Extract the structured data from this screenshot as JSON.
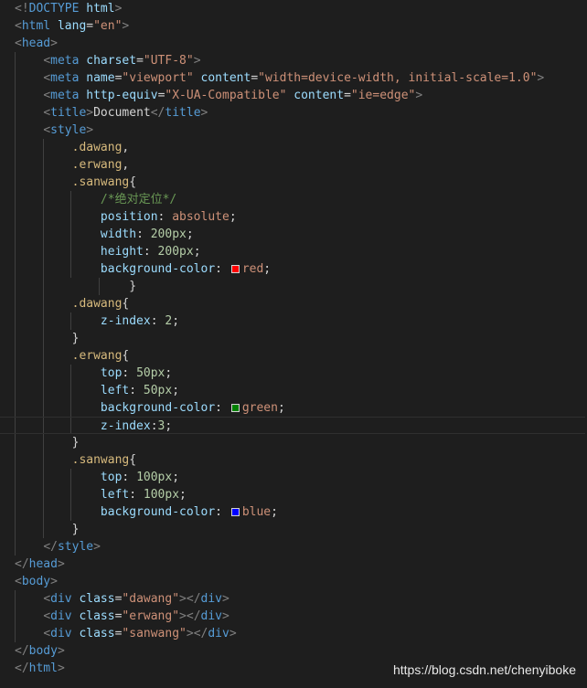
{
  "code_lines": [
    {
      "indent": "",
      "tokens": [
        [
          "pn",
          "<!"
        ],
        [
          "tg",
          "DOCTYPE"
        ],
        [
          "tx",
          " "
        ],
        [
          "at",
          "html"
        ],
        [
          "pn",
          ">"
        ]
      ]
    },
    {
      "indent": "",
      "tokens": [
        [
          "pn",
          "<"
        ],
        [
          "tg",
          "html"
        ],
        [
          "tx",
          " "
        ],
        [
          "at",
          "lang"
        ],
        [
          "tx",
          "="
        ],
        [
          "st",
          "\"en\""
        ],
        [
          "pn",
          ">"
        ]
      ]
    },
    {
      "indent": "",
      "tokens": [
        [
          "pn",
          "<"
        ],
        [
          "tg",
          "head"
        ],
        [
          "pn",
          ">"
        ]
      ]
    },
    {
      "indent": "    ",
      "tokens": [
        [
          "pn",
          "<"
        ],
        [
          "tg",
          "meta"
        ],
        [
          "tx",
          " "
        ],
        [
          "at",
          "charset"
        ],
        [
          "tx",
          "="
        ],
        [
          "st",
          "\"UTF-8\""
        ],
        [
          "pn",
          ">"
        ]
      ]
    },
    {
      "indent": "    ",
      "tokens": [
        [
          "pn",
          "<"
        ],
        [
          "tg",
          "meta"
        ],
        [
          "tx",
          " "
        ],
        [
          "at",
          "name"
        ],
        [
          "tx",
          "="
        ],
        [
          "st",
          "\"viewport\""
        ],
        [
          "tx",
          " "
        ],
        [
          "at",
          "content"
        ],
        [
          "tx",
          "="
        ],
        [
          "st",
          "\"width=device-width, initial-scale=1.0\""
        ],
        [
          "pn",
          ">"
        ]
      ]
    },
    {
      "indent": "    ",
      "tokens": [
        [
          "pn",
          "<"
        ],
        [
          "tg",
          "meta"
        ],
        [
          "tx",
          " "
        ],
        [
          "at",
          "http-equiv"
        ],
        [
          "tx",
          "="
        ],
        [
          "st",
          "\"X-UA-Compatible\""
        ],
        [
          "tx",
          " "
        ],
        [
          "at",
          "content"
        ],
        [
          "tx",
          "="
        ],
        [
          "st",
          "\"ie=edge\""
        ],
        [
          "pn",
          ">"
        ]
      ]
    },
    {
      "indent": "    ",
      "tokens": [
        [
          "pn",
          "<"
        ],
        [
          "tg",
          "title"
        ],
        [
          "pn",
          ">"
        ],
        [
          "tx",
          "Document"
        ],
        [
          "pn",
          "</"
        ],
        [
          "tg",
          "title"
        ],
        [
          "pn",
          ">"
        ]
      ]
    },
    {
      "indent": "    ",
      "tokens": [
        [
          "pn",
          "<"
        ],
        [
          "tg",
          "style"
        ],
        [
          "pn",
          ">"
        ]
      ]
    },
    {
      "indent": "        ",
      "tokens": [
        [
          "sl",
          ".dawang"
        ],
        [
          "tx",
          ","
        ]
      ]
    },
    {
      "indent": "        ",
      "tokens": [
        [
          "sl",
          ".erwang"
        ],
        [
          "tx",
          ","
        ]
      ]
    },
    {
      "indent": "        ",
      "tokens": [
        [
          "sl",
          ".sanwang"
        ],
        [
          "tx",
          "{"
        ]
      ]
    },
    {
      "indent": "            ",
      "tokens": [
        [
          "cm",
          "/*绝对定位*/"
        ]
      ]
    },
    {
      "indent": "            ",
      "tokens": [
        [
          "pr",
          "position"
        ],
        [
          "tx",
          ": "
        ],
        [
          "vl",
          "absolute"
        ],
        [
          "tx",
          ";"
        ]
      ]
    },
    {
      "indent": "            ",
      "tokens": [
        [
          "pr",
          "width"
        ],
        [
          "tx",
          ": "
        ],
        [
          "nm",
          "200px"
        ],
        [
          "tx",
          ";"
        ]
      ]
    },
    {
      "indent": "            ",
      "tokens": [
        [
          "pr",
          "height"
        ],
        [
          "tx",
          ": "
        ],
        [
          "nm",
          "200px"
        ],
        [
          "tx",
          ";"
        ]
      ]
    },
    {
      "indent": "            ",
      "tokens": [
        [
          "pr",
          "background-color"
        ],
        [
          "tx",
          ": "
        ],
        [
          "sw",
          "#ff0000"
        ],
        [
          "vl",
          "red"
        ],
        [
          "tx",
          ";"
        ]
      ]
    },
    {
      "indent": "                ",
      "tokens": [
        [
          "tx",
          "}"
        ]
      ]
    },
    {
      "indent": "        ",
      "tokens": [
        [
          "sl",
          ".dawang"
        ],
        [
          "tx",
          "{"
        ]
      ]
    },
    {
      "indent": "            ",
      "tokens": [
        [
          "pr",
          "z-index"
        ],
        [
          "tx",
          ": "
        ],
        [
          "nm",
          "2"
        ],
        [
          "tx",
          ";"
        ]
      ]
    },
    {
      "indent": "        ",
      "tokens": [
        [
          "tx",
          "}"
        ]
      ]
    },
    {
      "indent": "        ",
      "tokens": [
        [
          "sl",
          ".erwang"
        ],
        [
          "tx",
          "{"
        ]
      ]
    },
    {
      "indent": "            ",
      "tokens": [
        [
          "pr",
          "top"
        ],
        [
          "tx",
          ": "
        ],
        [
          "nm",
          "50px"
        ],
        [
          "tx",
          ";"
        ]
      ]
    },
    {
      "indent": "            ",
      "tokens": [
        [
          "pr",
          "left"
        ],
        [
          "tx",
          ": "
        ],
        [
          "nm",
          "50px"
        ],
        [
          "tx",
          ";"
        ]
      ]
    },
    {
      "indent": "            ",
      "tokens": [
        [
          "pr",
          "background-color"
        ],
        [
          "tx",
          ": "
        ],
        [
          "sw",
          "#008000"
        ],
        [
          "vl",
          "green"
        ],
        [
          "tx",
          ";"
        ]
      ]
    },
    {
      "indent": "            ",
      "current": true,
      "tokens": [
        [
          "pr",
          "z-index"
        ],
        [
          "tx",
          ":"
        ],
        [
          "nm",
          "3"
        ],
        [
          "tx",
          ";"
        ]
      ]
    },
    {
      "indent": "        ",
      "tokens": [
        [
          "tx",
          "}"
        ]
      ]
    },
    {
      "indent": "        ",
      "tokens": [
        [
          "sl",
          ".sanwang"
        ],
        [
          "tx",
          "{"
        ]
      ]
    },
    {
      "indent": "            ",
      "tokens": [
        [
          "pr",
          "top"
        ],
        [
          "tx",
          ": "
        ],
        [
          "nm",
          "100px"
        ],
        [
          "tx",
          ";"
        ]
      ]
    },
    {
      "indent": "            ",
      "tokens": [
        [
          "pr",
          "left"
        ],
        [
          "tx",
          ": "
        ],
        [
          "nm",
          "100px"
        ],
        [
          "tx",
          ";"
        ]
      ]
    },
    {
      "indent": "            ",
      "tokens": [
        [
          "pr",
          "background-color"
        ],
        [
          "tx",
          ": "
        ],
        [
          "sw",
          "#0000ff"
        ],
        [
          "vl",
          "blue"
        ],
        [
          "tx",
          ";"
        ]
      ]
    },
    {
      "indent": "        ",
      "tokens": [
        [
          "tx",
          "}"
        ]
      ]
    },
    {
      "indent": "    ",
      "tokens": [
        [
          "pn",
          "</"
        ],
        [
          "tg",
          "style"
        ],
        [
          "pn",
          ">"
        ]
      ]
    },
    {
      "indent": "",
      "tokens": [
        [
          "pn",
          "</"
        ],
        [
          "tg",
          "head"
        ],
        [
          "pn",
          ">"
        ]
      ]
    },
    {
      "indent": "",
      "tokens": [
        [
          "pn",
          "<"
        ],
        [
          "tg",
          "body"
        ],
        [
          "pn",
          ">"
        ]
      ]
    },
    {
      "indent": "    ",
      "tokens": [
        [
          "pn",
          "<"
        ],
        [
          "tg",
          "div"
        ],
        [
          "tx",
          " "
        ],
        [
          "at",
          "class"
        ],
        [
          "tx",
          "="
        ],
        [
          "st",
          "\"dawang\""
        ],
        [
          "pn",
          "></"
        ],
        [
          "tg",
          "div"
        ],
        [
          "pn",
          ">"
        ]
      ]
    },
    {
      "indent": "    ",
      "tokens": [
        [
          "pn",
          "<"
        ],
        [
          "tg",
          "div"
        ],
        [
          "tx",
          " "
        ],
        [
          "at",
          "class"
        ],
        [
          "tx",
          "="
        ],
        [
          "st",
          "\"erwang\""
        ],
        [
          "pn",
          "></"
        ],
        [
          "tg",
          "div"
        ],
        [
          "pn",
          ">"
        ]
      ]
    },
    {
      "indent": "    ",
      "tokens": [
        [
          "pn",
          "<"
        ],
        [
          "tg",
          "div"
        ],
        [
          "tx",
          " "
        ],
        [
          "at",
          "class"
        ],
        [
          "tx",
          "="
        ],
        [
          "st",
          "\"sanwang\""
        ],
        [
          "pn",
          "></"
        ],
        [
          "tg",
          "div"
        ],
        [
          "pn",
          ">"
        ]
      ]
    },
    {
      "indent": "",
      "tokens": [
        [
          "pn",
          "</"
        ],
        [
          "tg",
          "body"
        ],
        [
          "pn",
          ">"
        ]
      ]
    },
    {
      "indent": "",
      "tokens": [
        [
          "pn",
          "</"
        ],
        [
          "tg",
          "html"
        ],
        [
          "pn",
          ">"
        ]
      ]
    }
  ],
  "watermark": "https://blog.csdn.net/chenyiboke"
}
